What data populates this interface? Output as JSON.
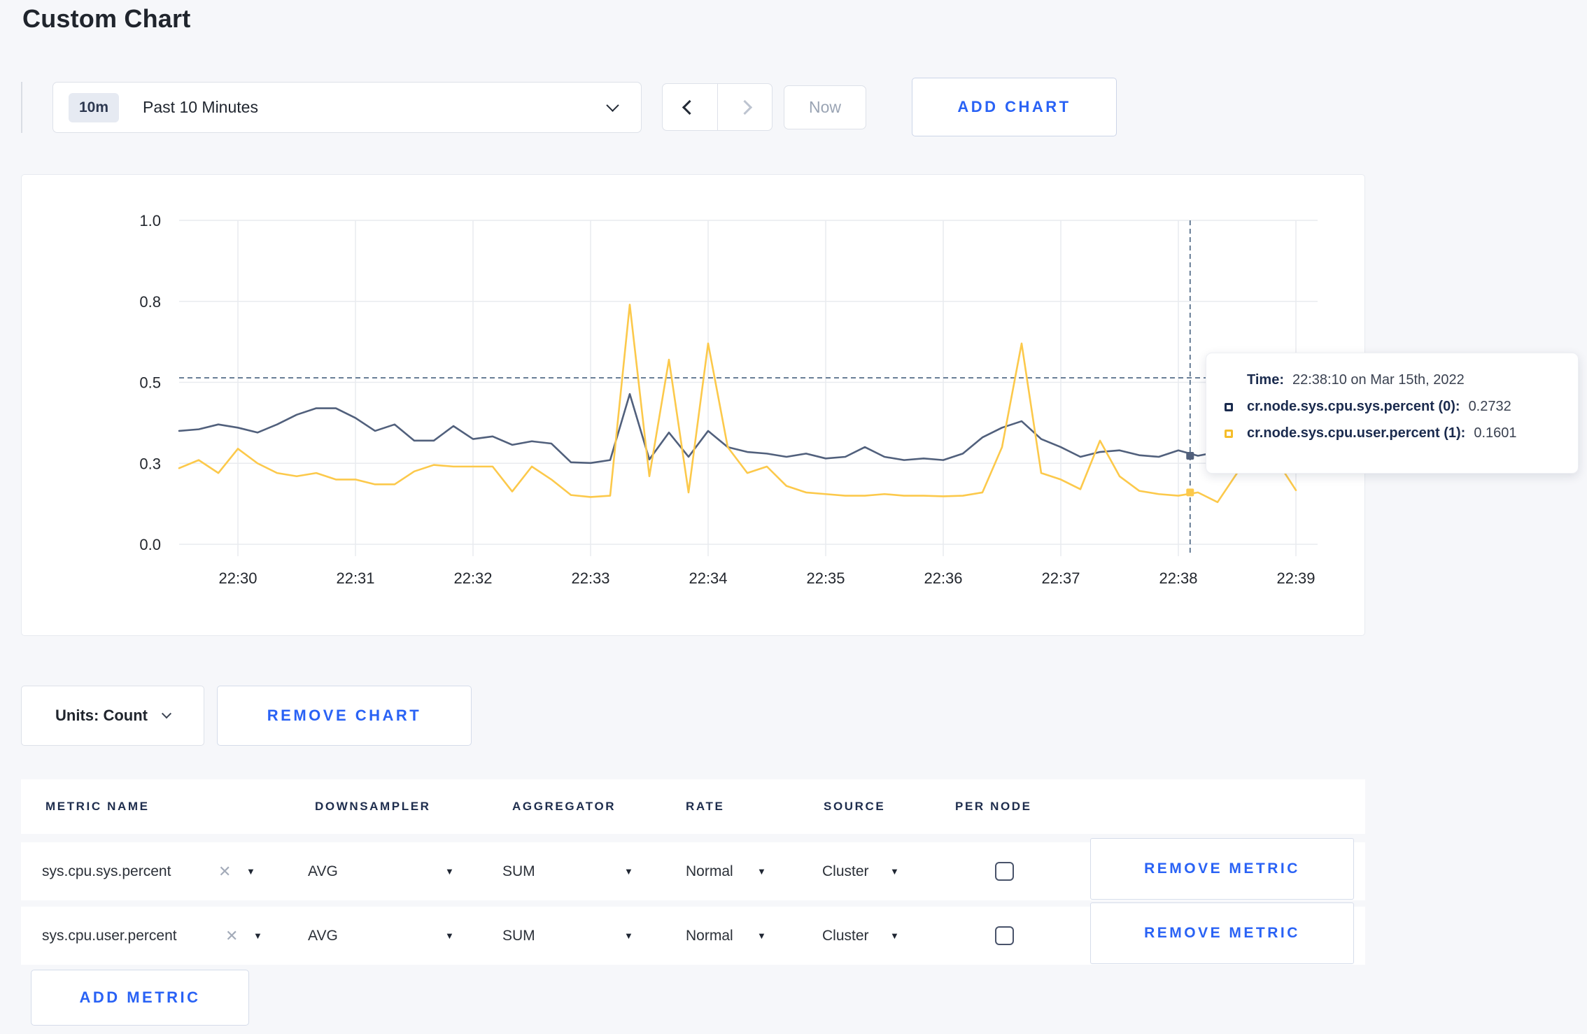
{
  "page": {
    "title": "Custom Chart"
  },
  "colors": {
    "accent_blue": "#2962f5",
    "navy": "#1b2b4e",
    "line_sys": "#51607c",
    "line_user": "#fcc94b"
  },
  "toolbar": {
    "range_badge": "10m",
    "range_label": "Past 10 Minutes",
    "now_label": "Now",
    "add_chart_label": "ADD CHART"
  },
  "chart_data": {
    "type": "line",
    "title": "",
    "xlabel": "",
    "ylabel": "",
    "ylim": [
      0,
      1
    ],
    "grid": true,
    "legend_position": "tooltip",
    "x_interval_seconds": 10,
    "x_start_time": "22:29:30",
    "y_ticks": [
      {
        "label": "0.0",
        "pos": 0
      },
      {
        "label": "0.3",
        "pos": 0.25
      },
      {
        "label": "0.5",
        "pos": 0.5
      },
      {
        "label": "0.8",
        "pos": 0.75
      },
      {
        "label": "1.0",
        "pos": 1.0
      }
    ],
    "x_ticks": [
      {
        "label": "22:30",
        "index": 3
      },
      {
        "label": "22:31",
        "index": 9
      },
      {
        "label": "22:32",
        "index": 15
      },
      {
        "label": "22:33",
        "index": 21
      },
      {
        "label": "22:34",
        "index": 27
      },
      {
        "label": "22:35",
        "index": 33
      },
      {
        "label": "22:36",
        "index": 39
      },
      {
        "label": "22:37",
        "index": 45
      },
      {
        "label": "22:38",
        "index": 51
      },
      {
        "label": "22:39",
        "index": 57
      }
    ],
    "series": [
      {
        "name": "cr.node.sys.cpu.sys.percent",
        "color": "#51607c",
        "values": [
          0.35,
          0.355,
          0.37,
          0.36,
          0.345,
          0.37,
          0.4,
          0.42,
          0.42,
          0.39,
          0.35,
          0.37,
          0.32,
          0.32,
          0.365,
          0.325,
          0.333,
          0.307,
          0.318,
          0.311,
          0.253,
          0.251,
          0.26,
          0.464,
          0.262,
          0.345,
          0.27,
          0.35,
          0.3,
          0.285,
          0.28,
          0.27,
          0.28,
          0.265,
          0.27,
          0.3,
          0.27,
          0.26,
          0.265,
          0.26,
          0.28,
          0.33,
          0.36,
          0.38,
          0.325,
          0.3,
          0.27,
          0.285,
          0.29,
          0.275,
          0.27,
          0.29,
          0.2732,
          0.285,
          0.28,
          0.285,
          0.28,
          0.285
        ]
      },
      {
        "name": "cr.node.sys.cpu.user.percent",
        "color": "#fcc94b",
        "values": [
          0.235,
          0.26,
          0.22,
          0.295,
          0.25,
          0.22,
          0.21,
          0.22,
          0.2,
          0.2,
          0.185,
          0.185,
          0.225,
          0.245,
          0.24,
          0.24,
          0.24,
          0.163,
          0.24,
          0.2,
          0.152,
          0.146,
          0.15,
          0.74,
          0.21,
          0.57,
          0.16,
          0.62,
          0.3,
          0.22,
          0.24,
          0.18,
          0.16,
          0.155,
          0.15,
          0.15,
          0.155,
          0.15,
          0.15,
          0.148,
          0.15,
          0.16,
          0.3,
          0.62,
          0.22,
          0.2,
          0.17,
          0.32,
          0.21,
          0.165,
          0.155,
          0.15,
          0.1601,
          0.13,
          0.22,
          0.26,
          0.26,
          0.167
        ]
      }
    ],
    "hover": {
      "index": 51.6,
      "time": "22:38:10",
      "hline_value": 0.514,
      "points": [
        {
          "series": "cr.node.sys.cpu.sys.percent",
          "value": 0.2732,
          "color": "#51607c"
        },
        {
          "series": "cr.node.sys.cpu.user.percent",
          "value": 0.1601,
          "color": "#fcc94b"
        }
      ]
    }
  },
  "tooltip": {
    "time_label": "Time:",
    "time_value": "22:38:10 on Mar 15th, 2022",
    "rows": [
      {
        "name": "cr.node.sys.cpu.sys.percent (0):",
        "value": "0.2732",
        "color": "#1b2b4e"
      },
      {
        "name": "cr.node.sys.cpu.user.percent (1):",
        "value": "0.1601",
        "color": "#f5bd2b"
      }
    ]
  },
  "units_row": {
    "units_label": "Units: Count",
    "remove_chart_label": "REMOVE CHART"
  },
  "metrics_table": {
    "headers": [
      "METRIC NAME",
      "DOWNSAMPLER",
      "AGGREGATOR",
      "RATE",
      "SOURCE",
      "PER NODE"
    ],
    "rows": [
      {
        "metric": "sys.cpu.sys.percent",
        "downsampler": "AVG",
        "aggregator": "SUM",
        "rate": "Normal",
        "source": "Cluster",
        "per_node_checked": false,
        "remove_label": "REMOVE METRIC"
      },
      {
        "metric": "sys.cpu.user.percent",
        "downsampler": "AVG",
        "aggregator": "SUM",
        "rate": "Normal",
        "source": "Cluster",
        "per_node_checked": false,
        "remove_label": "REMOVE METRIC"
      }
    ],
    "add_metric_label": "ADD METRIC"
  }
}
